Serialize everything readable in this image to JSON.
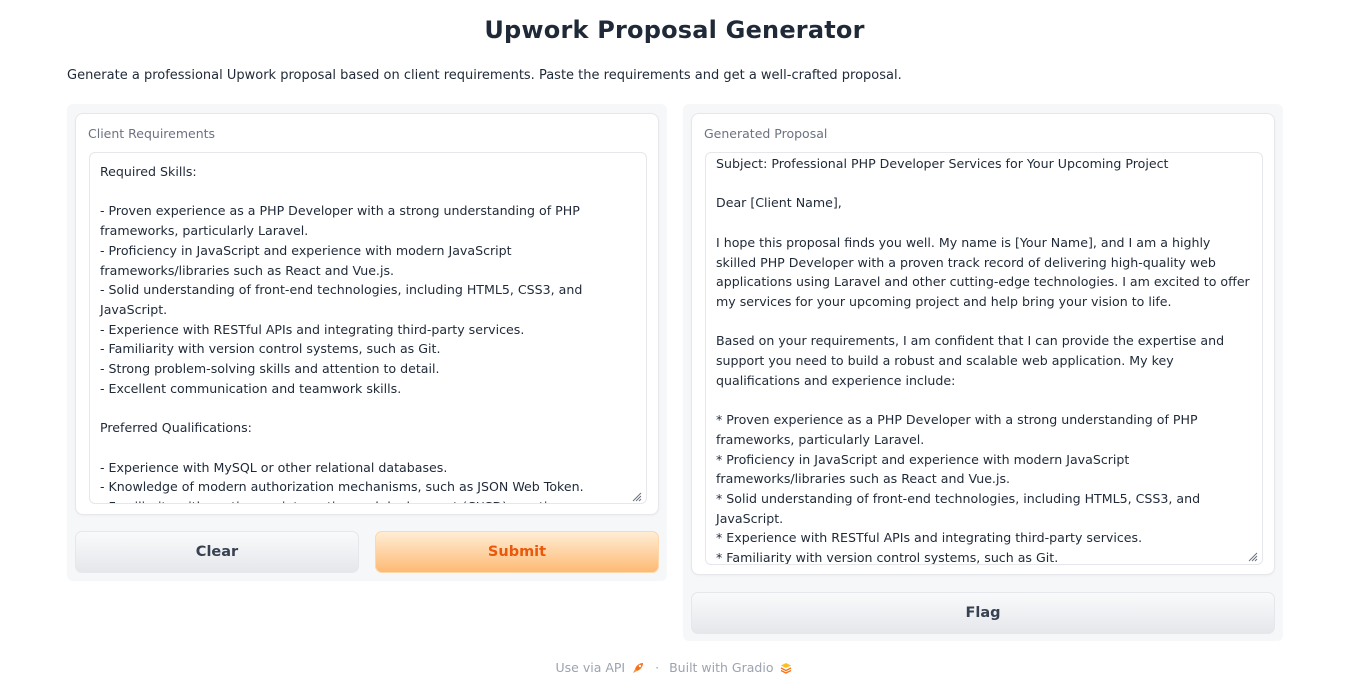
{
  "header": {
    "title": "Upwork Proposal Generator",
    "description": "Generate a professional Upwork proposal based on client requirements. Paste the requirements and get a well-crafted proposal."
  },
  "input_panel": {
    "label": "Client Requirements",
    "value": "Required Skills:\n\n- Proven experience as a PHP Developer with a strong understanding of PHP frameworks, particularly Laravel.\n- Proficiency in JavaScript and experience with modern JavaScript frameworks/libraries such as React and Vue.js.\n- Solid understanding of front-end technologies, including HTML5, CSS3, and JavaScript.\n- Experience with RESTful APIs and integrating third-party services.\n- Familiarity with version control systems, such as Git.\n- Strong problem-solving skills and attention to detail.\n- Excellent communication and teamwork skills.\n\nPreferred Qualifications:\n\n- Experience with MySQL or other relational databases.\n- Knowledge of modern authorization mechanisms, such as JSON Web Token.\n- Familiarity with continuous integration and deployment (CI/CD) practices."
  },
  "output_panel": {
    "label": "Generated Proposal",
    "value": "Subject: Professional PHP Developer Services for Your Upcoming Project\n\nDear [Client Name],\n\nI hope this proposal finds you well. My name is [Your Name], and I am a highly skilled PHP Developer with a proven track record of delivering high-quality web applications using Laravel and other cutting-edge technologies. I am excited to offer my services for your upcoming project and help bring your vision to life.\n\nBased on your requirements, I am confident that I can provide the expertise and support you need to build a robust and scalable web application. My key qualifications and experience include:\n\n* Proven experience as a PHP Developer with a strong understanding of PHP frameworks, particularly Laravel.\n* Proficiency in JavaScript and experience with modern JavaScript frameworks/libraries such as React and Vue.js.\n* Solid understanding of front-end technologies, including HTML5, CSS3, and JavaScript.\n* Experience with RESTful APIs and integrating third-party services.\n* Familiarity with version control systems, such as Git.\n* Strong problem-solving skills and attention to detail."
  },
  "buttons": {
    "clear": "Clear",
    "submit": "Submit",
    "flag": "Flag"
  },
  "footer": {
    "api_link": "Use via API",
    "separator": "·",
    "built_with": "Built with Gradio"
  },
  "colors": {
    "accent": "#ea580c",
    "submit_bg": "#fdba74"
  }
}
